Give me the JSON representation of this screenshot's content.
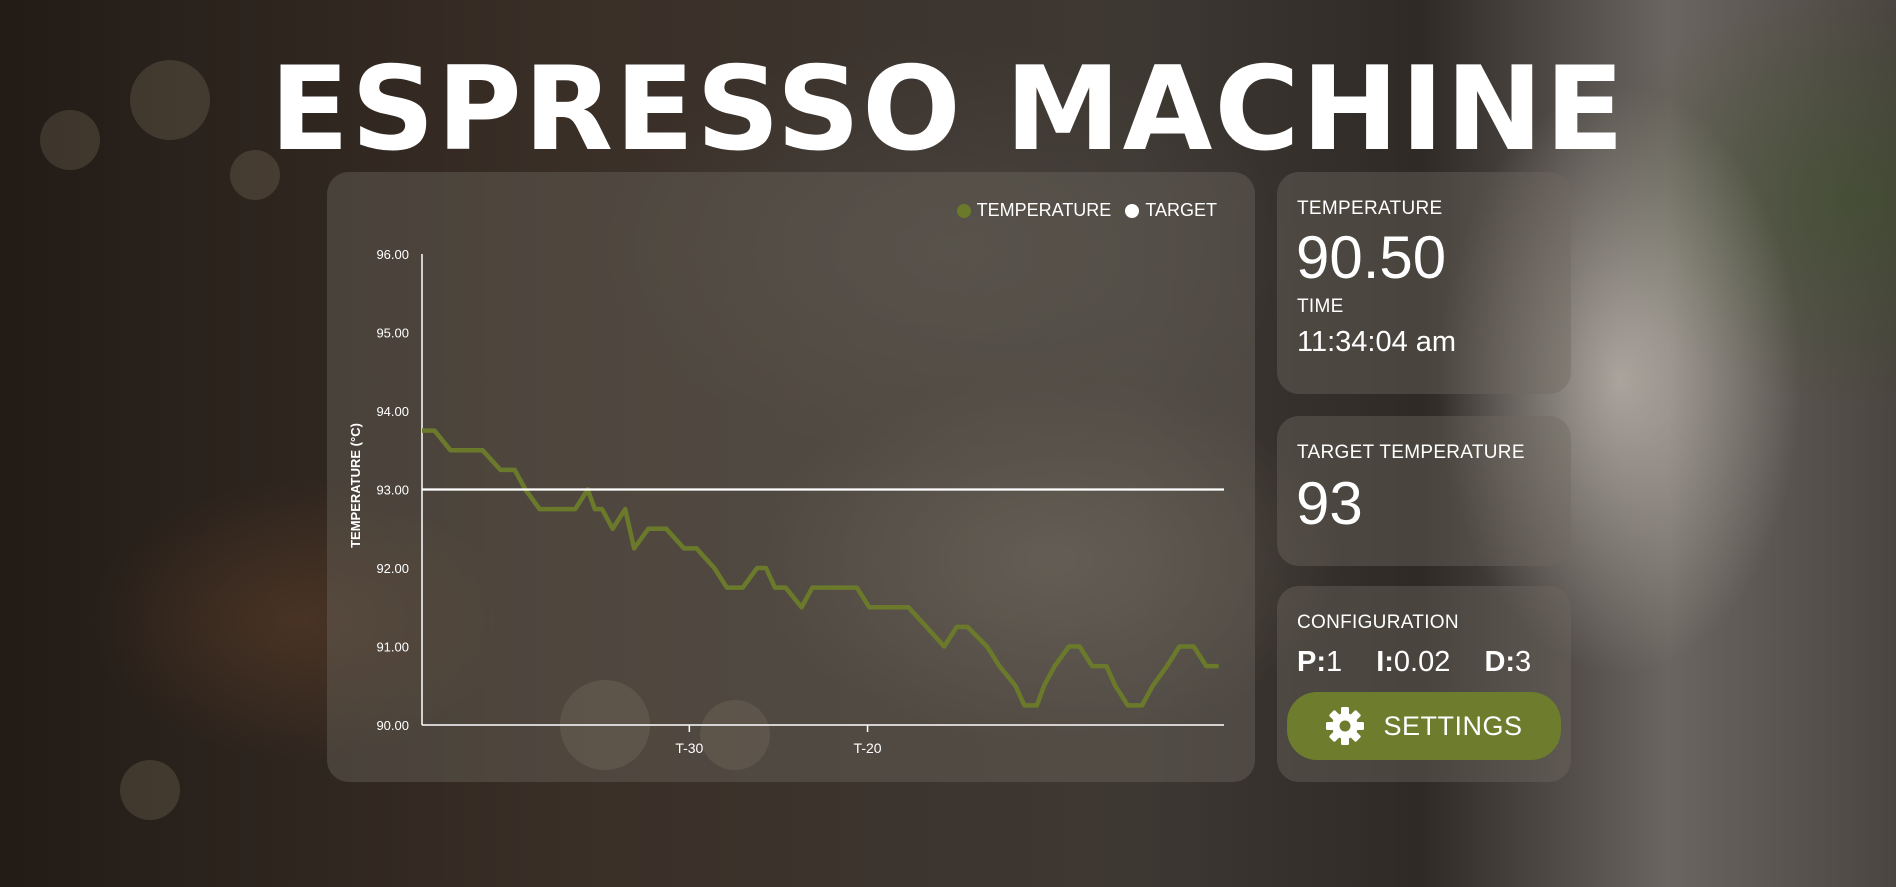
{
  "title": "ESPRESSO MACHINE",
  "colors": {
    "temperature": "#6b7a2a",
    "target": "#ffffff",
    "settings_button": "#6e7c2e"
  },
  "readings": {
    "temperature_label": "TEMPERATURE",
    "temperature_value": "90.50",
    "time_label": "TIME",
    "time_value": "11:34:04 am"
  },
  "target": {
    "label": "TARGET TEMPERATURE",
    "value": "93"
  },
  "config": {
    "label": "CONFIGURATION",
    "p_key": "P:",
    "p_value": "1",
    "i_key": "I:",
    "i_value": "0.02",
    "d_key": "D:",
    "d_value": "3",
    "settings_label": "SETTINGS",
    "settings_icon": "gear-icon"
  },
  "chart_data": {
    "type": "line",
    "ylabel": "TEMPERATURE (°C)",
    "ylim": [
      90,
      96
    ],
    "yticks": [
      "96.00",
      "95.00",
      "94.00",
      "93.00",
      "92.00",
      "91.00",
      "90.00"
    ],
    "xlim": [
      -45,
      0
    ],
    "xticks": [
      {
        "value": -30,
        "label": "T-30"
      },
      {
        "value": -20,
        "label": "T-20"
      }
    ],
    "legend": "top-right",
    "series": [
      {
        "name": "TEMPERATURE",
        "x": [
          -45,
          -44.3,
          -43.4,
          -42.9,
          -41.6,
          -40.6,
          -39.8,
          -39.2,
          -38.4,
          -37.6,
          -36.4,
          -35.7,
          -35.3,
          -34.9,
          -34.3,
          -33.6,
          -33.1,
          -32.3,
          -31.3,
          -30.3,
          -29.6,
          -28.6,
          -27.9,
          -27.0,
          -26.2,
          -25.7,
          -25.2,
          -24.6,
          -23.7,
          -23.1,
          -22.5,
          -21.6,
          -20.6,
          -19.9,
          -19.0,
          -17.7,
          -16.7,
          -15.7,
          -15.0,
          -14.4,
          -13.3,
          -12.6,
          -11.7,
          -11.2,
          -10.5,
          -10.1,
          -9.5,
          -8.7,
          -8.1,
          -7.4,
          -6.6,
          -6.1,
          -5.4,
          -4.6,
          -4.0,
          -3.2,
          -2.5,
          -1.7,
          -1.0,
          -0.3
        ],
        "y": [
          93.75,
          93.75,
          93.5,
          93.5,
          93.5,
          93.25,
          93.25,
          93.0,
          92.75,
          92.75,
          92.75,
          93.0,
          92.75,
          92.75,
          92.5,
          92.75,
          92.25,
          92.5,
          92.5,
          92.25,
          92.25,
          92.0,
          91.75,
          91.75,
          92.0,
          92.0,
          91.75,
          91.75,
          91.5,
          91.75,
          91.75,
          91.75,
          91.75,
          91.5,
          91.5,
          91.5,
          91.25,
          91.0,
          91.25,
          91.25,
          91.0,
          90.75,
          90.5,
          90.25,
          90.25,
          90.5,
          90.75,
          91.0,
          91.0,
          90.75,
          90.75,
          90.5,
          90.25,
          90.25,
          90.5,
          90.75,
          91.0,
          91.0,
          90.75,
          90.75
        ]
      },
      {
        "name": "TARGET",
        "x": [
          -45,
          0
        ],
        "y": [
          93,
          93
        ]
      }
    ]
  }
}
